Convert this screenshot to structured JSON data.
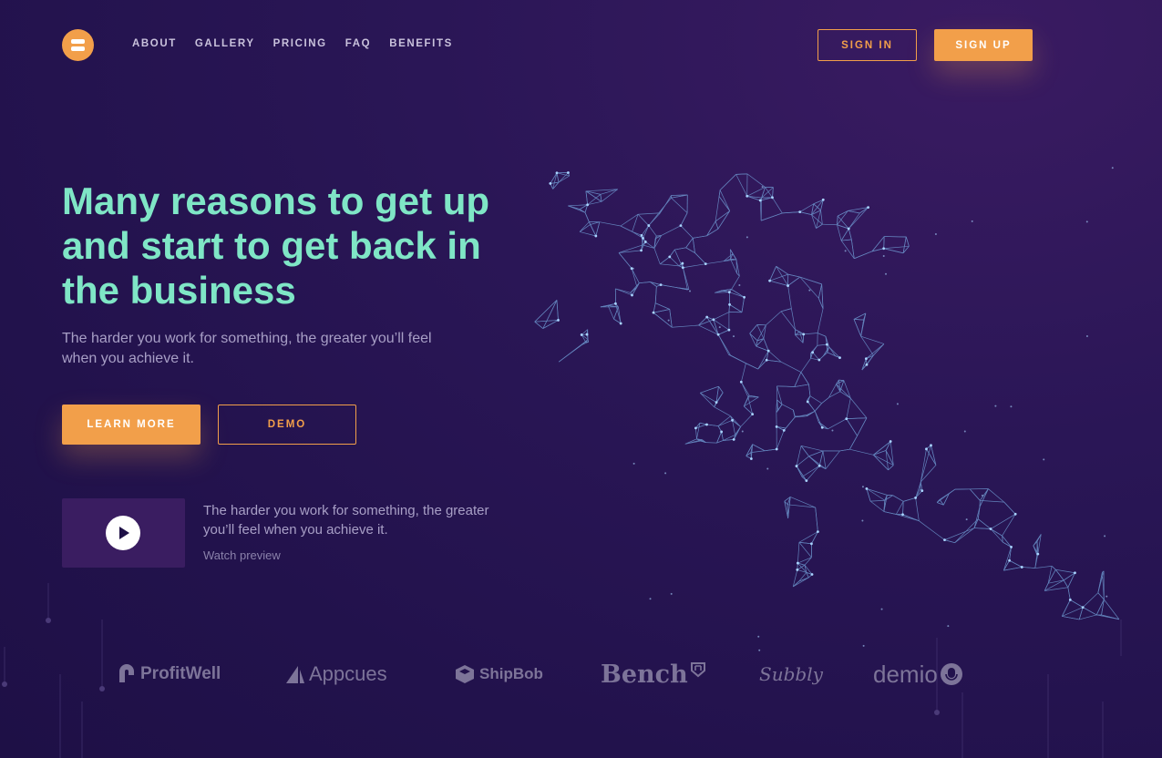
{
  "nav": {
    "items": [
      "ABOUT",
      "GALLERY",
      "PRICING",
      "FAQ",
      "BENEFITS"
    ],
    "signin_label": "SIGN IN",
    "signup_label": "SIGN UP"
  },
  "hero": {
    "title": "Many reasons to get up and start to get back in the business",
    "subtitle": "The harder you work for something, the greater you’ll feel when you achieve it.",
    "learn_label": "LEARN MORE",
    "demo_label": "DEMO"
  },
  "video": {
    "text": "The harder you work for something, the greater you’ll feel when you achieve it.",
    "link": "Watch preview"
  },
  "brands": [
    "ProfitWell",
    "Appcues",
    "ShipBob",
    "Bench",
    "Subbly",
    "demio"
  ],
  "colors": {
    "accent": "#f29f4a",
    "headline": "#7fe6c6",
    "background": "#22124c",
    "muted_text": "#a89fc6"
  },
  "icons": [
    "logo-icon",
    "play-icon",
    "runner-illustration"
  ]
}
